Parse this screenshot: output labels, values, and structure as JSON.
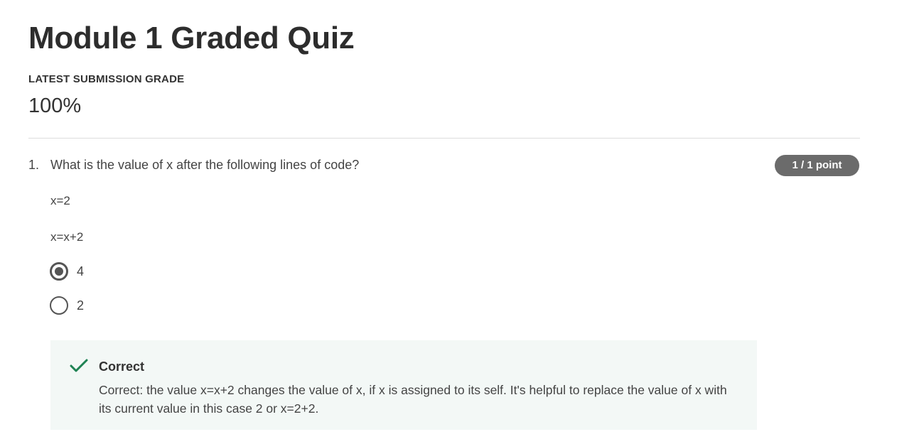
{
  "page": {
    "title": "Module 1 Graded Quiz",
    "grade_label": "LATEST SUBMISSION GRADE",
    "grade_value": "100%"
  },
  "question": {
    "number": "1.",
    "text": "What is the value of x after the following lines of code?",
    "points": "1 / 1 point",
    "code_lines": [
      "x=2",
      "x=x+2"
    ],
    "options": [
      {
        "label": "4",
        "selected": true
      },
      {
        "label": "2",
        "selected": false
      }
    ]
  },
  "feedback": {
    "status": "Correct",
    "text": "Correct: the value x=x+2 changes the value of x, if x is assigned to its self. It's helpful to replace the value of x with its current value in this case 2 or x=2+2.",
    "icon": "checkmark-icon",
    "accent_color": "#1f8354",
    "background_color": "#f3f8f6"
  },
  "colors": {
    "badge_background": "#6b6b6b",
    "divider": "#dcdcdc"
  }
}
